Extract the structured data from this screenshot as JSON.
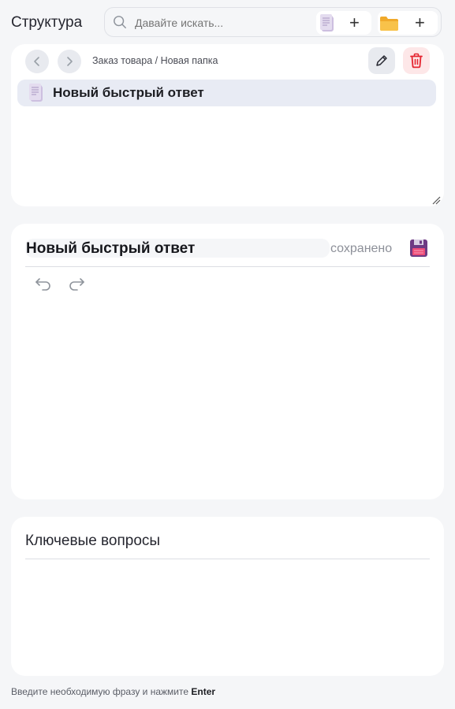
{
  "header": {
    "title": "Структура",
    "search": {
      "placeholder": "Давайте искать..."
    },
    "add_doc_label": "+",
    "add_folder_label": "+"
  },
  "structure_panel": {
    "breadcrumb": "Заказ товара / Новая папка",
    "items": [
      {
        "label": "Новый быстрый ответ",
        "icon": "document-icon",
        "selected": true
      }
    ]
  },
  "editor": {
    "title": "Новый быстрый ответ",
    "status": "сохранено"
  },
  "key_questions": {
    "title": "Ключевые вопросы"
  },
  "footer": {
    "hint_prefix": "Введите необходимую фразу и нажмите",
    "hint_key": "Enter"
  },
  "colors": {
    "accent_delete": "#e5242f",
    "floppy": "#6e3a83",
    "folder": "#f6b73c",
    "selected_row": "#e8ebf4"
  }
}
